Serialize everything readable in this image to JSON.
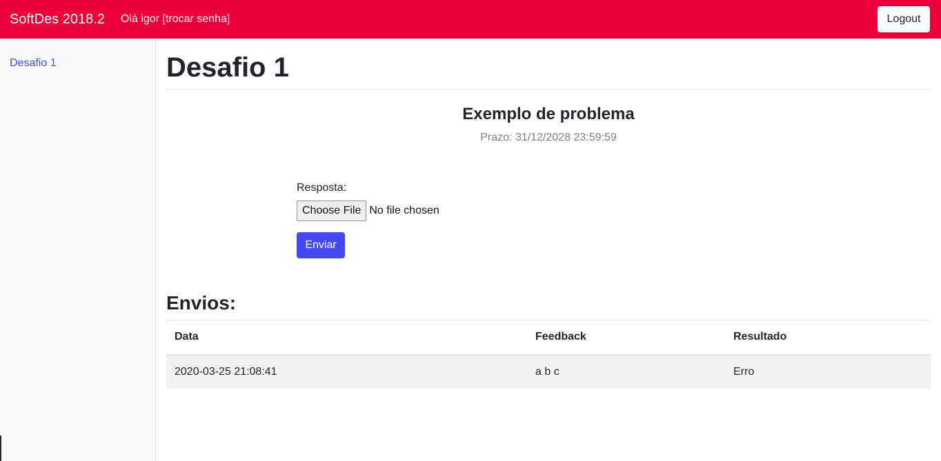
{
  "navbar": {
    "brand": "SoftDes 2018.2",
    "greeting": "Olá igor",
    "change_password": "[trocar senha]",
    "logout_label": "Logout",
    "background_color": "#ec003a"
  },
  "sidebar": {
    "items": [
      {
        "label": "Desafio 1"
      }
    ]
  },
  "main": {
    "title": "Desafio 1",
    "problem_title": "Exemplo de problema",
    "deadline": "Prazo: 31/12/2028 23:59:59",
    "form": {
      "answer_label": "Resposta:",
      "choose_file_label": "Choose File",
      "file_status": "No file chosen",
      "submit_label": "Enviar"
    },
    "submissions": {
      "heading": "Envios:",
      "columns": [
        "Data",
        "Feedback",
        "Resultado"
      ],
      "rows": [
        {
          "date": "2020-03-25 21:08:41",
          "feedback": "a b c",
          "result": "Erro"
        }
      ]
    }
  },
  "colors": {
    "accent": "#4349f5",
    "navbar": "#ec003a",
    "sidebar_bg": "#f8f9fa"
  }
}
